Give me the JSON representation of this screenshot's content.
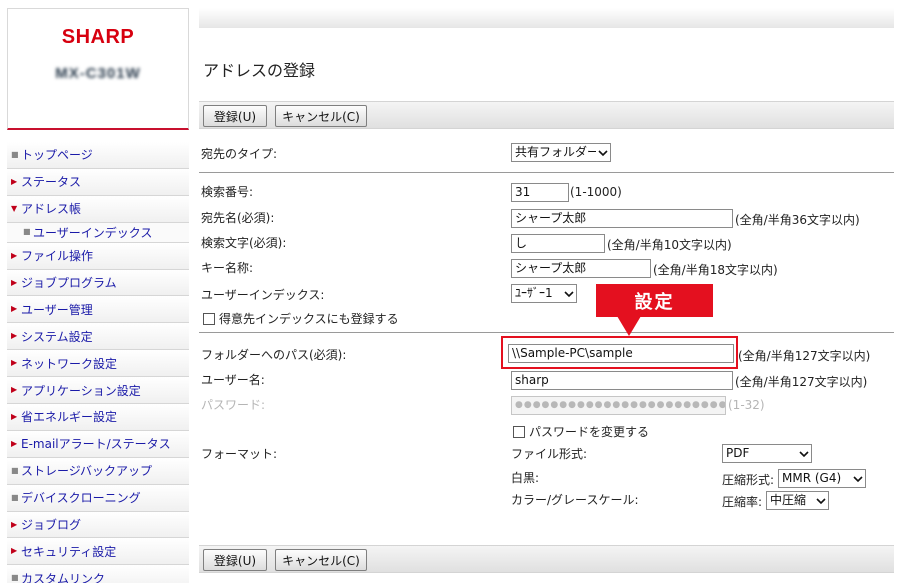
{
  "brand": {
    "logo_text": "SHARP",
    "model_text": "MX-C301W"
  },
  "nav": {
    "items": [
      {
        "label": "トップページ",
        "marker": "square"
      },
      {
        "label": "ステータス",
        "marker": "arrow-right"
      },
      {
        "label": "アドレス帳",
        "marker": "arrow-down"
      },
      {
        "label": "ユーザーインデックス",
        "marker": "square"
      },
      {
        "label": "ファイル操作",
        "marker": "arrow-right"
      },
      {
        "label": "ジョブプログラム",
        "marker": "arrow-right"
      },
      {
        "label": "ユーザー管理",
        "marker": "arrow-right"
      },
      {
        "label": "システム設定",
        "marker": "arrow-right"
      },
      {
        "label": "ネットワーク設定",
        "marker": "arrow-right"
      },
      {
        "label": "アプリケーション設定",
        "marker": "arrow-right"
      },
      {
        "label": "省エネルギー設定",
        "marker": "arrow-right"
      },
      {
        "label": "E-mailアラート/ステータス",
        "marker": "arrow-right"
      },
      {
        "label": "ストレージバックアップ",
        "marker": "square"
      },
      {
        "label": "デバイスクローニング",
        "marker": "square"
      },
      {
        "label": "ジョブログ",
        "marker": "arrow-right"
      },
      {
        "label": "セキュリティ設定",
        "marker": "arrow-right"
      },
      {
        "label": "カスタムリンク",
        "marker": "square"
      }
    ]
  },
  "page": {
    "title": "アドレスの登録"
  },
  "toolbar": {
    "register_label": "登録(U)",
    "cancel_label": "キャンセル(C)"
  },
  "form": {
    "destination_type": {
      "label": "宛先のタイプ:",
      "value": "共有フォルダー"
    },
    "search_number": {
      "label": "検索番号:",
      "value": "31",
      "hint": "(1-1000)"
    },
    "address_name": {
      "label": "宛先名(必須):",
      "value": "シャープ太郎",
      "hint": "(全角/半角36文字以内)"
    },
    "search_string": {
      "label": "検索文字(必須):",
      "value": "し",
      "hint": "(全角/半角10文字以内)"
    },
    "key_name": {
      "label": "キー名称:",
      "value": "シャープ太郎",
      "hint": "(全角/半角18文字以内)"
    },
    "user_index": {
      "label": "ユーザーインデックス:",
      "value": "ﾕｰｻﾞｰ1"
    },
    "frequent_use": {
      "label": "得意先インデックスにも登録する",
      "checked": false
    },
    "folder_path": {
      "label": "フォルダーへのパス(必須):",
      "value": "\\\\Sample-PC\\sample",
      "hint": "(全角/半角127文字以内)"
    },
    "user_name": {
      "label": "ユーザー名:",
      "value": "sharp",
      "hint": "(全角/半角127文字以内)"
    },
    "password": {
      "label": "パスワード:",
      "value": "●●●●●●●●●●●●●●●●●●●●●●●●●●●●●●●●",
      "hint": "(1-32)"
    },
    "change_password": {
      "label": "パスワードを変更する",
      "checked": false
    },
    "format": {
      "label": "フォーマット:",
      "file_format_label": "ファイル形式:",
      "file_format_value": "PDF",
      "mono_label": "白黒:",
      "compression_mode_label": "圧縮形式:",
      "compression_mode_value": "MMR (G4)",
      "color_label": "カラー/グレースケール:",
      "compression_ratio_label": "圧縮率:",
      "compression_ratio_value": "中圧縮"
    }
  },
  "annotation": {
    "callout_text": "設定",
    "color": "#e4101f"
  }
}
